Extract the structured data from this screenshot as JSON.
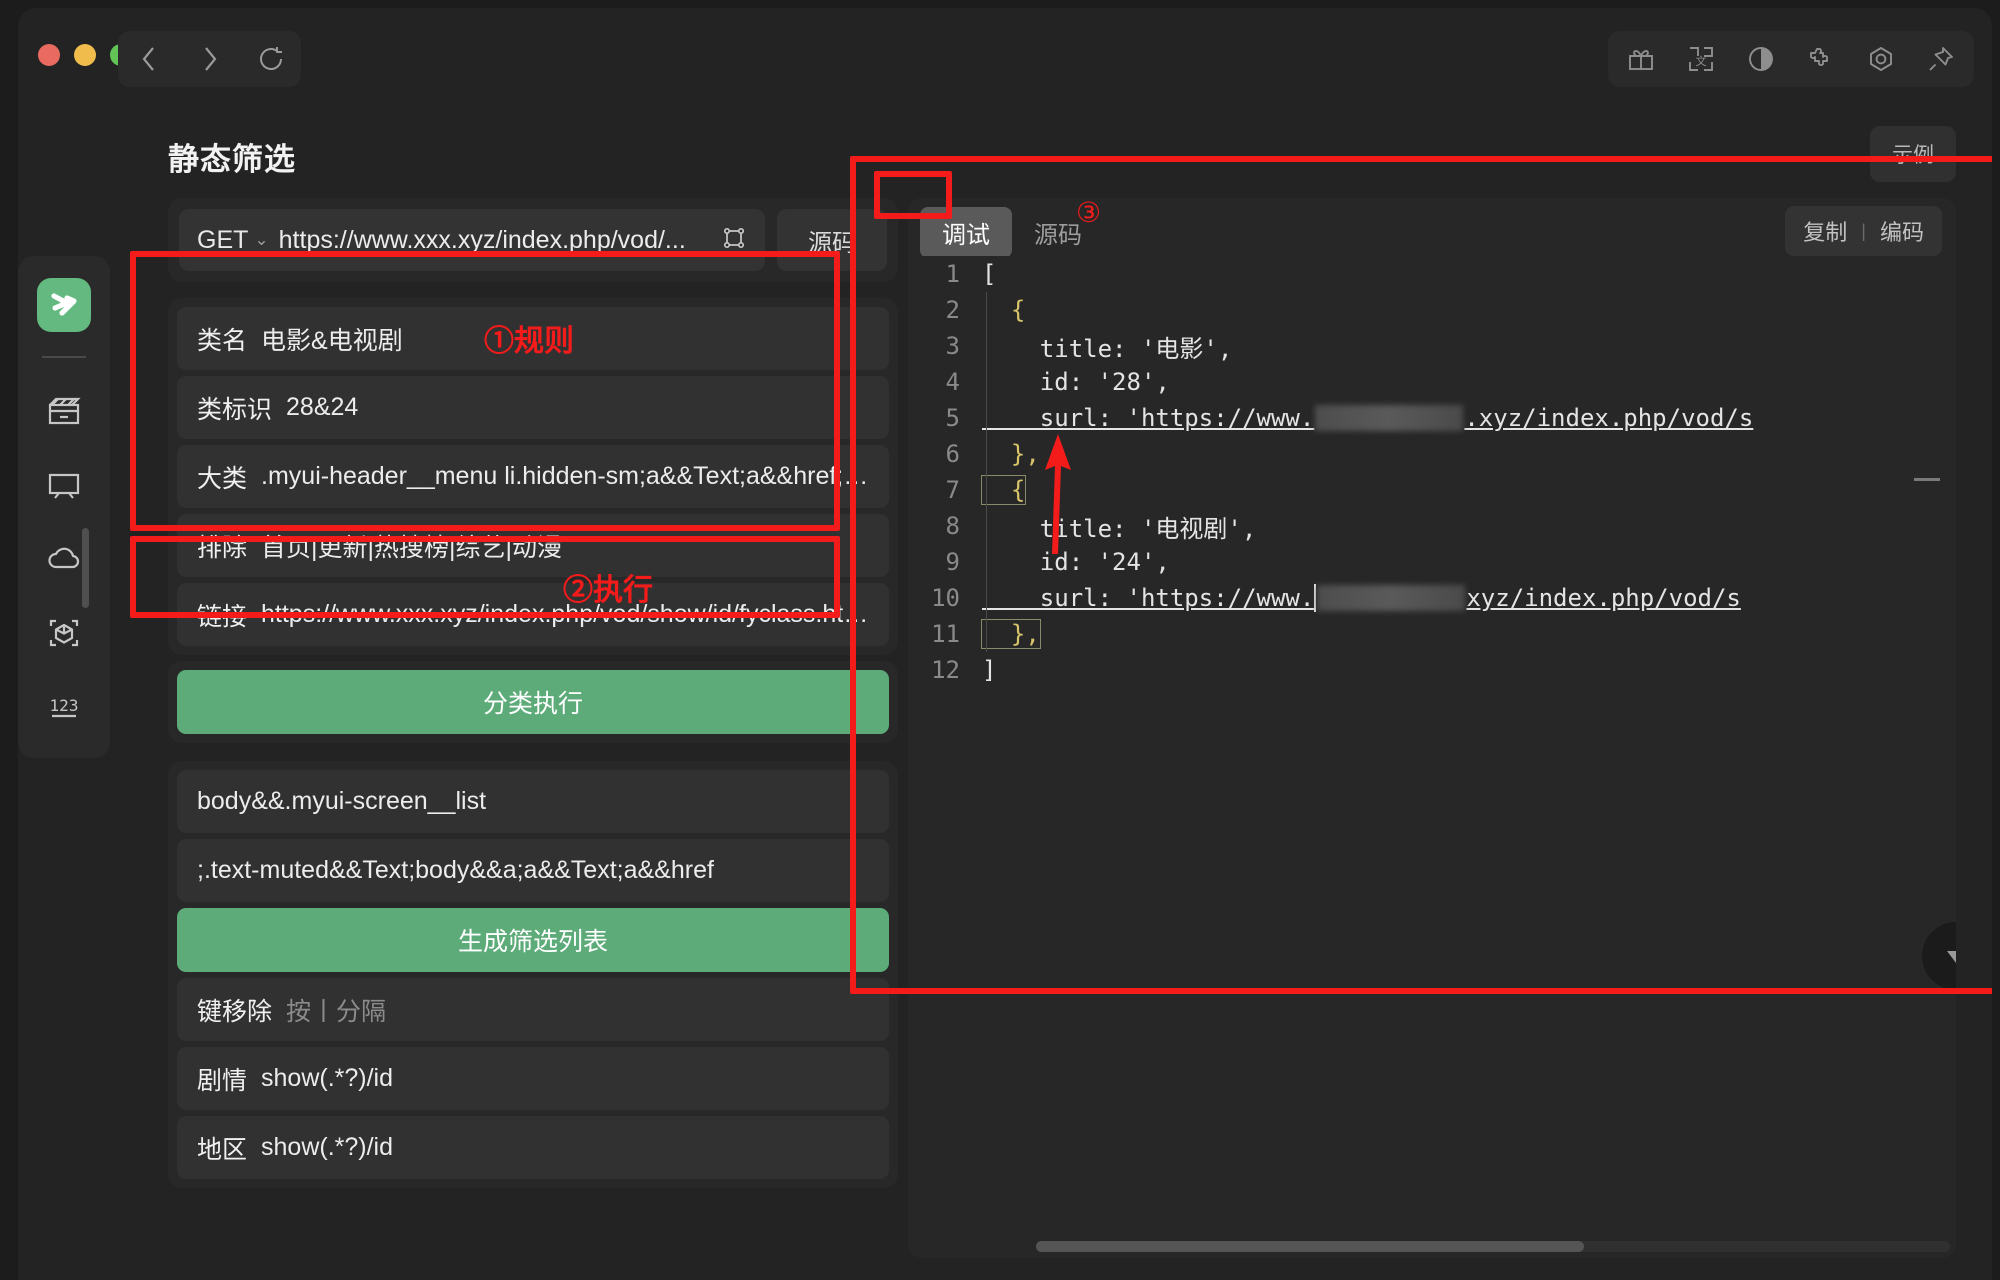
{
  "titlebar": {
    "nav": {
      "back": "back-arrow",
      "forward": "forward-arrow",
      "reload": "reload-arrow"
    },
    "tools": [
      "gift-icon",
      "translate-icon",
      "contrast-icon",
      "puzzle-icon",
      "settings-hex-icon",
      "pin-icon"
    ]
  },
  "sidebar": {
    "logo": "app-logo",
    "items": [
      {
        "icon": "clapperboard-icon",
        "name": "movies"
      },
      {
        "icon": "tv-icon",
        "name": "tv"
      },
      {
        "icon": "cloud-icon",
        "name": "cloud"
      },
      {
        "icon": "box-scan-icon",
        "name": "package"
      },
      {
        "icon": "numbers-icon",
        "name": "numbers"
      }
    ]
  },
  "page": {
    "title": "静态筛选",
    "example_btn": "示例"
  },
  "request": {
    "method": "GET",
    "method_caret": "⌄",
    "url": "https://www.xxx.xyz/index.php/vod/...",
    "source_btn": "源码"
  },
  "rules": {
    "fields": [
      {
        "label": "类名",
        "value": "电影&电视剧"
      },
      {
        "label": "类标识",
        "value": "28&24"
      },
      {
        "label": "大类",
        "value": ".myui-header__menu li.hidden-sm;a&&Text;a&&href;/ty..."
      },
      {
        "label": "排除",
        "value": "首页|更新|热搜榜|综艺|动漫"
      },
      {
        "label": "链接",
        "value": "https://www.xxx.xyz/index.php/vod/show/id/fyclass.html"
      }
    ],
    "execute_btn": "分类执行"
  },
  "filters": {
    "list_rule": "body&&.myui-screen__list",
    "item_rule": ";.text-muted&&Text;body&&a;a&&Text;a&&href",
    "generate_btn": "生成筛选列表",
    "rows": [
      {
        "label": "键移除",
        "value": "按丨分隔",
        "is_placeholder": true
      },
      {
        "label": "剧情",
        "value": "show(.*?)/id",
        "is_placeholder": false
      },
      {
        "label": "地区",
        "value": "show(.*?)/id",
        "is_placeholder": false
      }
    ]
  },
  "debug": {
    "tabs": [
      {
        "label": "调试",
        "active": true
      },
      {
        "label": "源码",
        "active": false
      }
    ],
    "copy_btn": "复制",
    "separator": "|",
    "encode_btn": "编码",
    "code_lines": [
      {
        "no": "1",
        "text": "["
      },
      {
        "no": "2",
        "text": "  {"
      },
      {
        "no": "3",
        "text": "    title: '电影',"
      },
      {
        "no": "4",
        "text": "    id: '28',"
      },
      {
        "no": "5",
        "text": "    surl: 'https://www."
      },
      {
        "no": "6",
        "text": "  },"
      },
      {
        "no": "7",
        "text": "  {"
      },
      {
        "no": "8",
        "text": "    title: '电视剧',"
      },
      {
        "no": "9",
        "text": "    id: '24',"
      },
      {
        "no": "10",
        "text": "    surl: 'https://www."
      },
      {
        "no": "11",
        "text": "  },"
      },
      {
        "no": "12",
        "text": "]"
      }
    ],
    "url_tail": ".xyz/index.php/vod/s",
    "url_tail2": "xyz/index.php/vod/s"
  },
  "annotations": {
    "rule_label": "①规则",
    "execute_label": "②执行",
    "debug_marker": "③",
    "color": "#f41b1b"
  }
}
